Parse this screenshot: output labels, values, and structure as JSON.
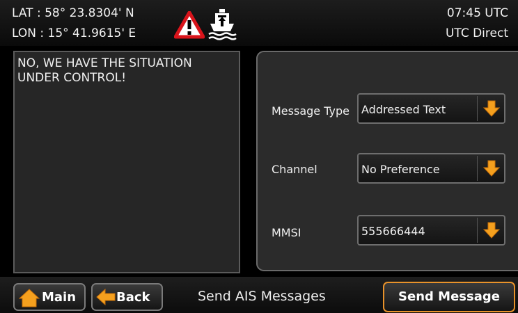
{
  "status": {
    "lat_line": "LAT : 58° 23.8304' N",
    "lon_line": "LON : 15° 41.9615' E",
    "time": "07:45 UTC",
    "time_source": "UTC Direct",
    "alert_icon": "warning-triangle-icon",
    "vessel_icon": "ship-icon"
  },
  "message": {
    "text": "NO, WE HAVE THE SITUATION\nUNDER CONTROL!"
  },
  "settings": {
    "message_type": {
      "label": "Message Type",
      "value": "Addressed Text"
    },
    "channel": {
      "label": "Channel",
      "value": "No Preference"
    },
    "mmsi": {
      "label": "MMSI",
      "value": "555666444"
    }
  },
  "bottom": {
    "main_label": "Main",
    "back_label": "Back",
    "title": "Send AIS Messages",
    "send_label": "Send Message"
  },
  "colors": {
    "accent": "#f5a01e",
    "alert_red": "#d9141b",
    "panel_bg": "#2b2b2b"
  }
}
